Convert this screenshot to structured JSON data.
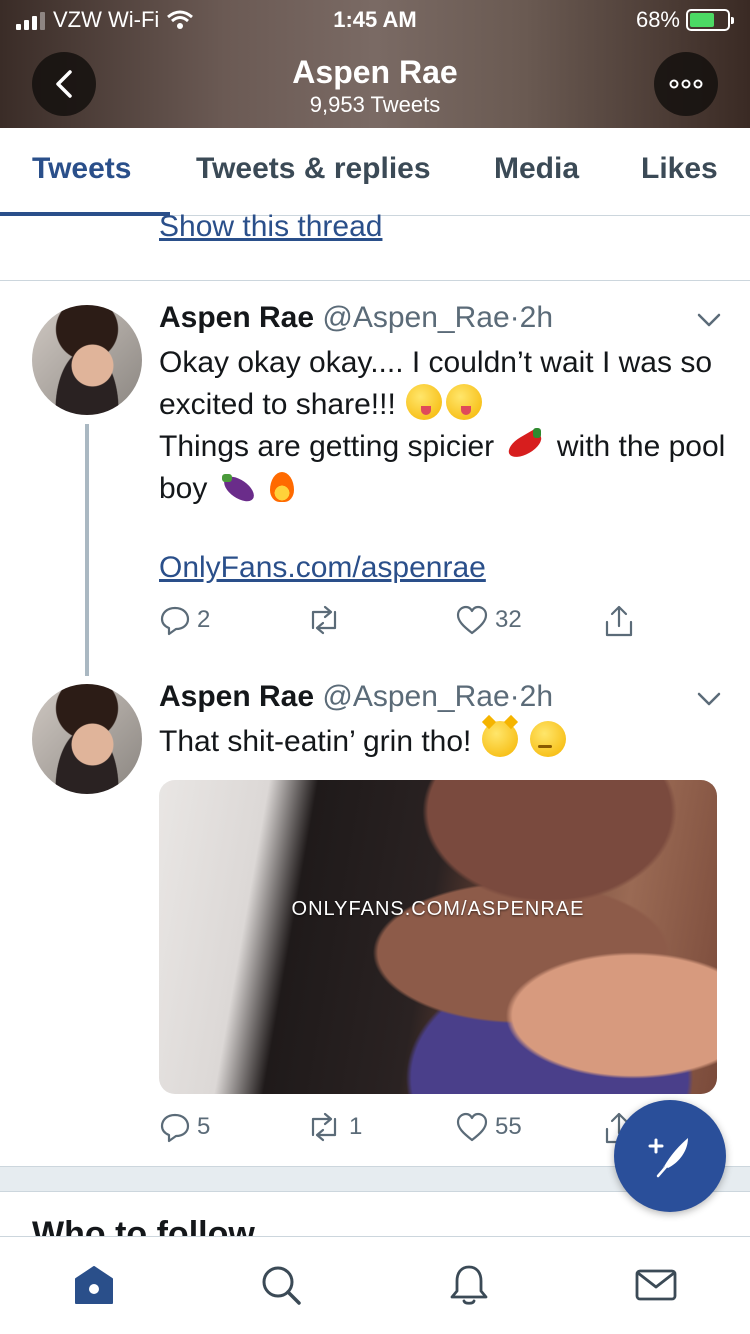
{
  "status_bar": {
    "carrier": "VZW Wi-Fi",
    "time": "1:45 AM",
    "battery_percent": "68%",
    "battery_level": 0.68
  },
  "header": {
    "title": "Aspen Rae",
    "subtitle": "9,953 Tweets"
  },
  "tabs": [
    {
      "label": "Tweets",
      "active": true
    },
    {
      "label": "Tweets & replies",
      "active": false
    },
    {
      "label": "Media",
      "active": false
    },
    {
      "label": "Likes",
      "active": false
    }
  ],
  "feed": {
    "show_thread": "Show this thread",
    "tweets": [
      {
        "name": "Aspen Rae",
        "handle": "@Aspen_Rae",
        "separator": "·",
        "time": "2h",
        "text_line1": "Okay okay okay.... I couldn’t wait I was so excited to share!!!",
        "text_line2a": "Things are getting spicier",
        "text_line2b": "with the pool boy",
        "emojis": [
          "yum-face-icon",
          "yum-face-icon",
          "hot-pepper-icon",
          "eggplant-icon",
          "fire-icon"
        ],
        "link": "OnlyFans.com/aspenrae",
        "replies": "2",
        "retweets": "",
        "likes": "32"
      },
      {
        "name": "Aspen Rae",
        "handle": "@Aspen_Rae",
        "separator": "·",
        "time": "2h",
        "text": "That shit-eatin’ grin tho!",
        "emojis": [
          "joy-cat-icon",
          "drooling-face-icon"
        ],
        "media_watermark": "ONLYFANS.COM/ASPENRAE",
        "replies": "5",
        "retweets": "1",
        "likes": "55"
      }
    ]
  },
  "who_to_follow": "Who to follow",
  "colors": {
    "accent": "#2a4f8a",
    "fab": "#2a4f9a",
    "muted": "#5b6b78"
  }
}
